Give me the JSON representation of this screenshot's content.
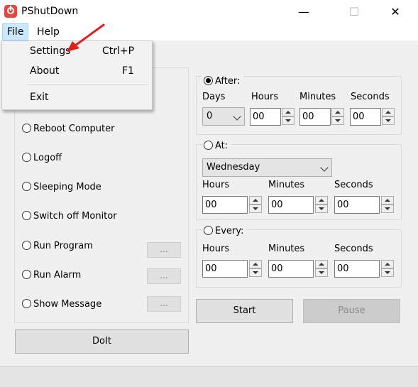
{
  "window": {
    "title": "PShutDown",
    "minimize_glyph": "—",
    "maximize_glyph": "☐",
    "close_glyph": "✕"
  },
  "menubar": {
    "file": "File",
    "help": "Help"
  },
  "file_menu": {
    "items": [
      {
        "label": "Settings",
        "shortcut": "Ctrl+P"
      },
      {
        "label": "About",
        "shortcut": "F1"
      },
      {
        "label": "Exit",
        "shortcut": ""
      }
    ]
  },
  "actions": {
    "options": [
      "Reboot Computer",
      "Logoff",
      "Sleeping Mode",
      "Switch off Monitor",
      "Run Program",
      "Run Alarm",
      "Show Message"
    ],
    "dots_label": "...",
    "doit_label": "DoIt"
  },
  "after": {
    "label": "After:",
    "selected": true,
    "headers": [
      "Days",
      "Hours",
      "Minutes",
      "Seconds"
    ],
    "days_value": "0",
    "hours_value": "00",
    "minutes_value": "00",
    "seconds_value": "00"
  },
  "at": {
    "label": "At:",
    "selected": false,
    "day_value": "Wednesday",
    "headers": [
      "Hours",
      "Minutes",
      "Seconds"
    ],
    "hours_value": "00",
    "minutes_value": "00",
    "seconds_value": "00"
  },
  "every": {
    "label": "Every:",
    "selected": false,
    "headers": [
      "Hours",
      "Minutes",
      "Seconds"
    ],
    "hours_value": "00",
    "minutes_value": "00",
    "seconds_value": "00"
  },
  "buttons": {
    "start": "Start",
    "pause": "Pause"
  },
  "colors": {
    "annotation_arrow": "#e0201b",
    "app_icon": "#e8453c",
    "menu_highlight": "#cce8ff"
  },
  "icons": {
    "app": "power-icon",
    "annotation": "red-arrow-icon"
  }
}
